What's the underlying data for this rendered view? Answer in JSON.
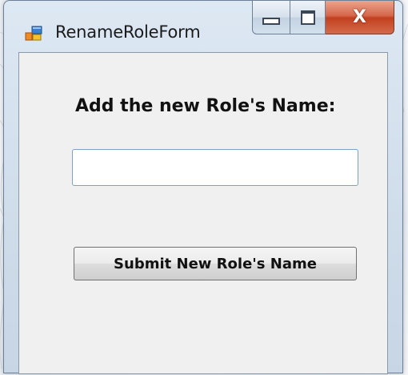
{
  "window": {
    "title": "RenameRoleForm",
    "icon": "form-app-icon"
  },
  "caption_buttons": {
    "minimize_icon": "minimize-icon",
    "maximize_icon": "maximize-icon",
    "close_label": "X"
  },
  "form": {
    "prompt": "Add the new Role's Name:",
    "role_name_value": "",
    "submit_label": "Submit New Role's Name"
  },
  "colors": {
    "close_button": "#c2401f",
    "input_border": "#7ea1c6",
    "client_background": "#f0f0f0"
  }
}
